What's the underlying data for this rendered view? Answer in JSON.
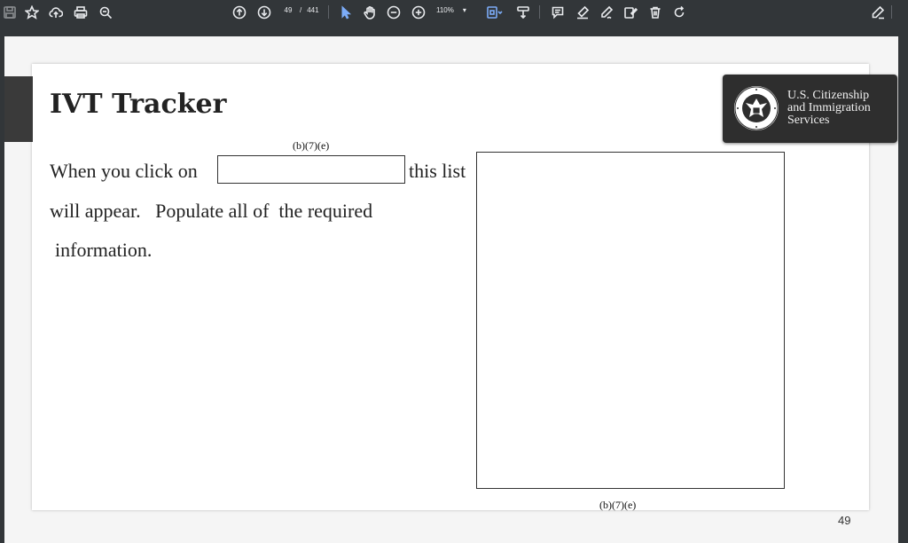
{
  "toolbar": {
    "left_icons": [
      "save-icon",
      "star-icon",
      "cloud-upload-icon",
      "print-icon",
      "zoom-search-icon"
    ],
    "page_current": "49",
    "page_separator": "/",
    "page_total": "441",
    "zoom_value": "110%",
    "zoom_caret": "▾",
    "tool_icons": [
      "select-arrow-icon",
      "hand-tool-icon",
      "zoom-out-icon",
      "zoom-in-icon"
    ],
    "right_icons": [
      "comment-icon",
      "highlight-icon",
      "draw-icon",
      "edit-text-icon",
      "delete-icon",
      "rotate-icon",
      "sign-icon"
    ],
    "accent": "#7cacf8"
  },
  "slide": {
    "title": "IVT Tracker",
    "line1_a": "When you click on",
    "line1_b": "this list",
    "line2": "will appear.   Populate all of  the required",
    "line3": "information.",
    "redaction_top": "(b)(7)(e)",
    "redaction_bottom": "(b)(7)(e)",
    "logo": {
      "line1": "U.S. Citizenship",
      "line2": "and Immigration",
      "line3": "Services"
    }
  },
  "page_number": "49"
}
